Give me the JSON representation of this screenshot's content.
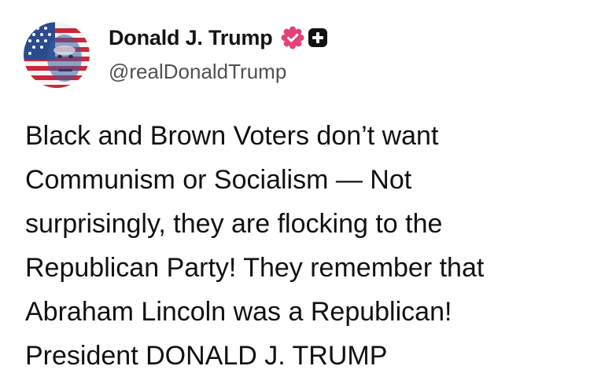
{
  "post": {
    "author": {
      "display_name": "Donald J. Trump",
      "handle": "@realDonaldTrump",
      "avatar_icon": "flag-portrait-avatar",
      "verified_icon": "verified-badge-icon",
      "plus_icon": "plus-badge-icon"
    },
    "body_lines": [
      "Black and Brown Voters don’t want",
      "Communism or Socialism — Not",
      "surprisingly, they are flocking to the",
      "Republican Party! They remember that",
      "Abraham Lincoln was a Republican!",
      "President DONALD J. TRUMP"
    ]
  },
  "colors": {
    "verified_badge": "#e5417b",
    "plus_badge": "#111111",
    "name_text": "#141414",
    "handle_text": "#505050",
    "body_text": "#111111"
  }
}
